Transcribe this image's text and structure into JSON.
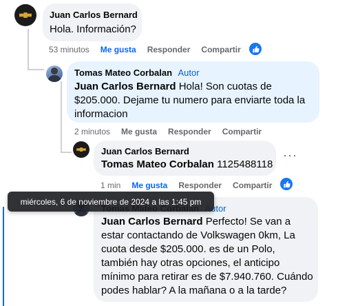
{
  "comments": [
    {
      "author": "Juan Carlos Bernard",
      "text": "Hola. Información?",
      "time": "53 minutos",
      "like": "Me gusta",
      "reply": "Responder",
      "share": "Compartir"
    },
    {
      "author": "Tomas Mateo Corbalan",
      "badge": "Autor",
      "mention": "Juan Carlos Bernard",
      "text": " Hola! Son cuotas de $205.000. Dejame tu numero para enviarte toda la informacion",
      "time": "2 minutos",
      "like": "Me gusta",
      "reply": "Responder",
      "share": "Compartir"
    },
    {
      "author": "Juan Carlos Bernard",
      "mention": "Tomas Mateo Corbalan",
      "text": " 1125488118",
      "time": "1 min",
      "like": "Me gusta",
      "reply": "Responder",
      "share": "Compartir"
    },
    {
      "author": "Tomas Mateo Corbalan",
      "badge": "Autor",
      "mention": "Juan Carlos Bernard",
      "text": " Perfecto! Se van a estar contactando de Volkswagen 0km, La cuota desde $205.000. es de un Polo, también hay otras opciones, el anticipo mínimo para retirar es de $7.940.760. Cuándo podes hablar? A la mañana o a la tarde?"
    }
  ],
  "tooltip": "miércoles, 6 de noviembre de 2024 a las 1:45 pm",
  "colors": {
    "accent": "#0866ff",
    "bubble_grey": "#f0f2f5",
    "bubble_blue": "#e7f3ff",
    "author_badge": "#0064d1",
    "meta_text": "#65676b"
  },
  "icons": {
    "like_reaction": "thumbs-up-icon",
    "more_options": "more-options-icon"
  }
}
